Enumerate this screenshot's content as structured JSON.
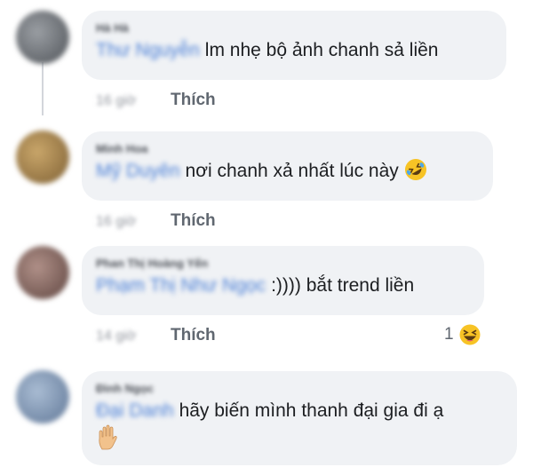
{
  "thread": {
    "comments": [
      {
        "author": "Hà Hà",
        "mention": "Thư Nguyễn",
        "text": "lm nhẹ bộ ảnh chanh sả liền",
        "emoji": "",
        "timestamp": "16 giờ",
        "like_label": "Thích",
        "avatar_color": "#6f7378"
      },
      {
        "author": "Minh Hoa",
        "mention": "Mỹ Duyên",
        "text": "nơi chanh xả nhất lúc này",
        "emoji": "rolling-on-floor-laughing-emoji",
        "timestamp": "16 giờ",
        "like_label": "Thích",
        "avatar_color": "#a8874f"
      },
      {
        "author": "Phan Thị Hoàng Yến",
        "mention": "Phạm Thị Như Ngọc",
        "text": ":)))) bắt trend liền",
        "emoji": "",
        "timestamp": "14 giờ",
        "like_label": "Thích",
        "reaction_count": "1",
        "reaction_icon": "laughing-emoji",
        "avatar_color": "#8c6c64"
      },
      {
        "author": "Đình Ngọc",
        "mention": "Đại Danh",
        "text": "hãy biến mình thanh đại gia đi ạ",
        "emoji": "raised-hand-emoji",
        "avatar_color": "#7f97b6"
      }
    ]
  }
}
